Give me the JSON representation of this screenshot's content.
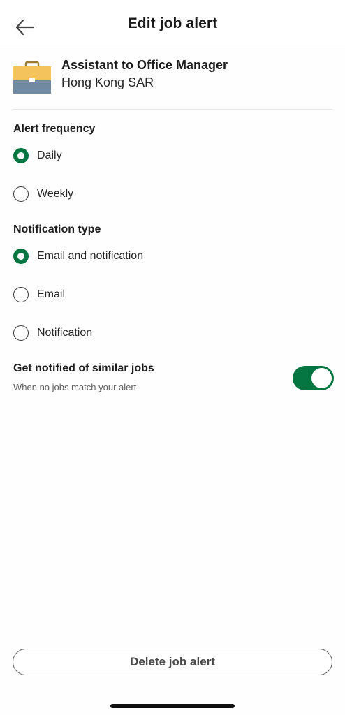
{
  "header": {
    "title": "Edit job alert",
    "back_icon": "arrow-left-icon"
  },
  "job": {
    "title": "Assistant to Office Manager",
    "location": "Hong Kong SAR",
    "icon": "briefcase-icon"
  },
  "alert_frequency": {
    "label": "Alert frequency",
    "options": [
      {
        "label": "Daily",
        "selected": true
      },
      {
        "label": "Weekly",
        "selected": false
      }
    ]
  },
  "notification_type": {
    "label": "Notification type",
    "options": [
      {
        "label": "Email and notification",
        "selected": true
      },
      {
        "label": "Email",
        "selected": false
      },
      {
        "label": "Notification",
        "selected": false
      }
    ]
  },
  "similar_jobs": {
    "title": "Get notified of similar jobs",
    "subtitle": "When no jobs match your alert",
    "enabled": true
  },
  "delete_button": {
    "label": "Delete job alert"
  },
  "colors": {
    "accent": "#057642",
    "briefcase_top": "#f5c35b",
    "briefcase_bottom": "#7189a1"
  }
}
